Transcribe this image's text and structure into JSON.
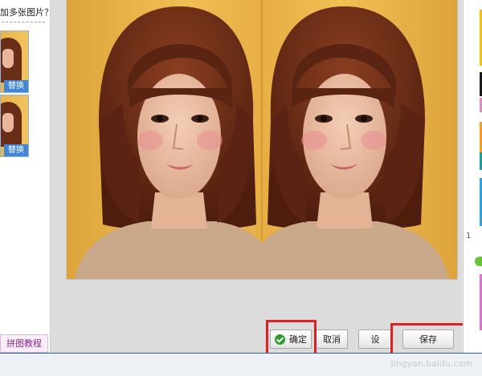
{
  "left_panel": {
    "title": "加多张图片？",
    "thumbnails": [
      {
        "replace_label": "替换"
      },
      {
        "replace_label": "替换"
      }
    ],
    "tutorial_label": "拼图教程"
  },
  "toolbar": {
    "ok_label": "确定",
    "cancel_label": "取消",
    "set_label": "设",
    "save_label": "保存"
  },
  "right_strip": {
    "number": "1",
    "swatch_colors": [
      "#f6c000",
      "#1a1a1a",
      "#e88ac0",
      "#ff9a1a",
      "#15a39b",
      "#2aa6e6",
      "#e070d6"
    ]
  },
  "colors": {
    "highlight": "#e02020",
    "accent": "#3f86d6"
  },
  "watermark": "jingyan.baidu.com"
}
